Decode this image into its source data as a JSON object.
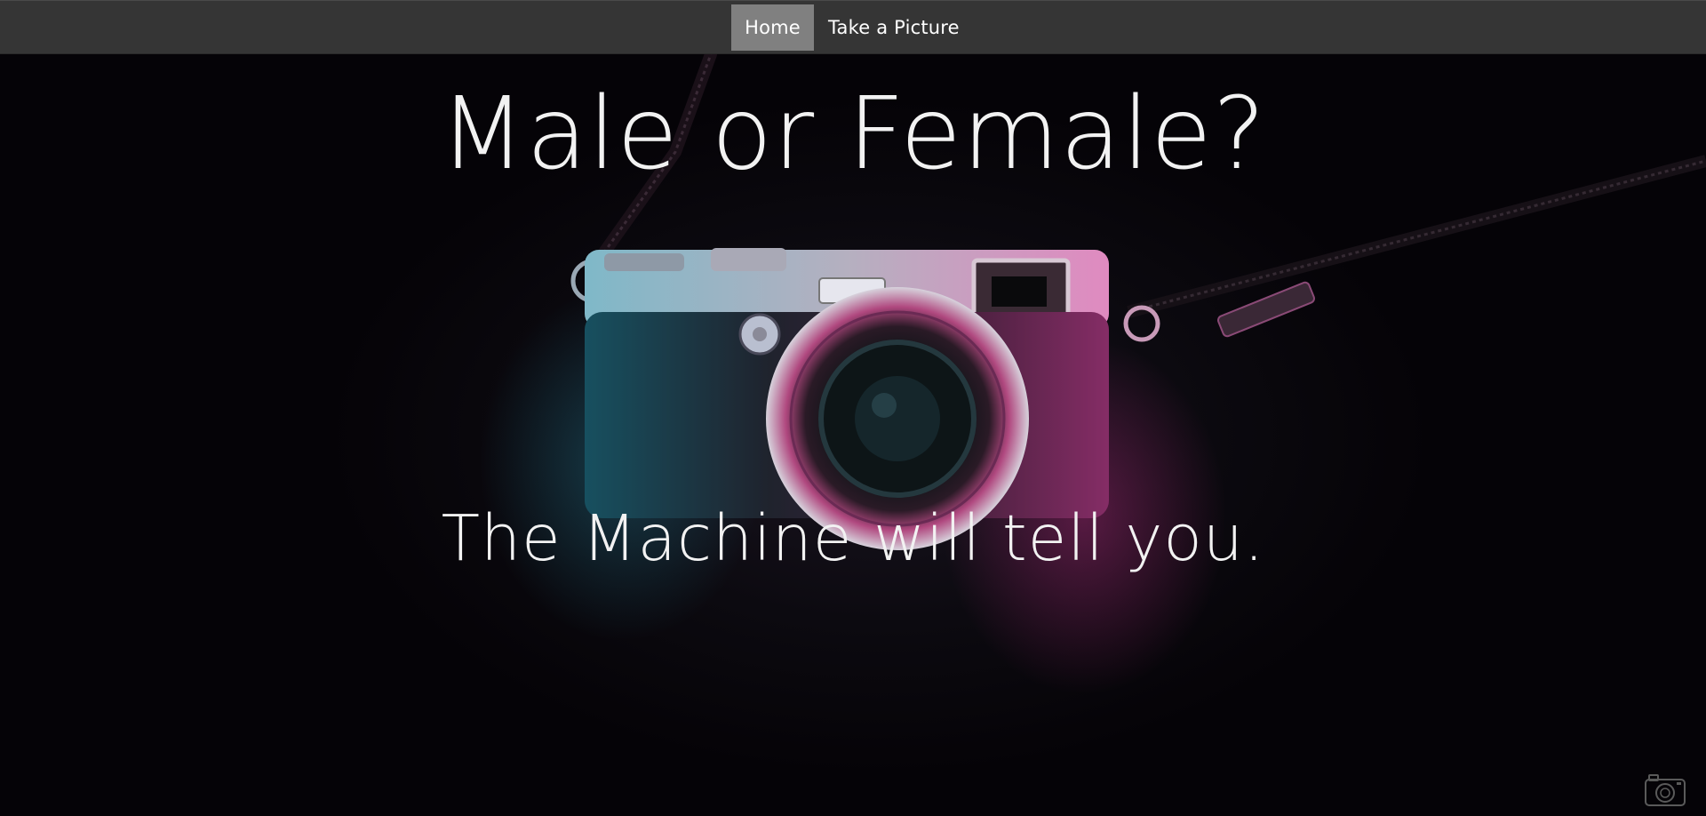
{
  "nav": {
    "items": [
      {
        "label": "Home",
        "active": true
      },
      {
        "label": "Take a Picture",
        "active": false
      }
    ]
  },
  "hero": {
    "title": "Male or Female?",
    "subtitle": "The Machine will tell you."
  },
  "icons": {
    "corner": "camera-icon"
  },
  "colors": {
    "navbar": "#353535",
    "nav_active": "#808080",
    "background": "#050307",
    "accent_pink": "#e0359c",
    "accent_cyan": "#2fb8d8"
  }
}
